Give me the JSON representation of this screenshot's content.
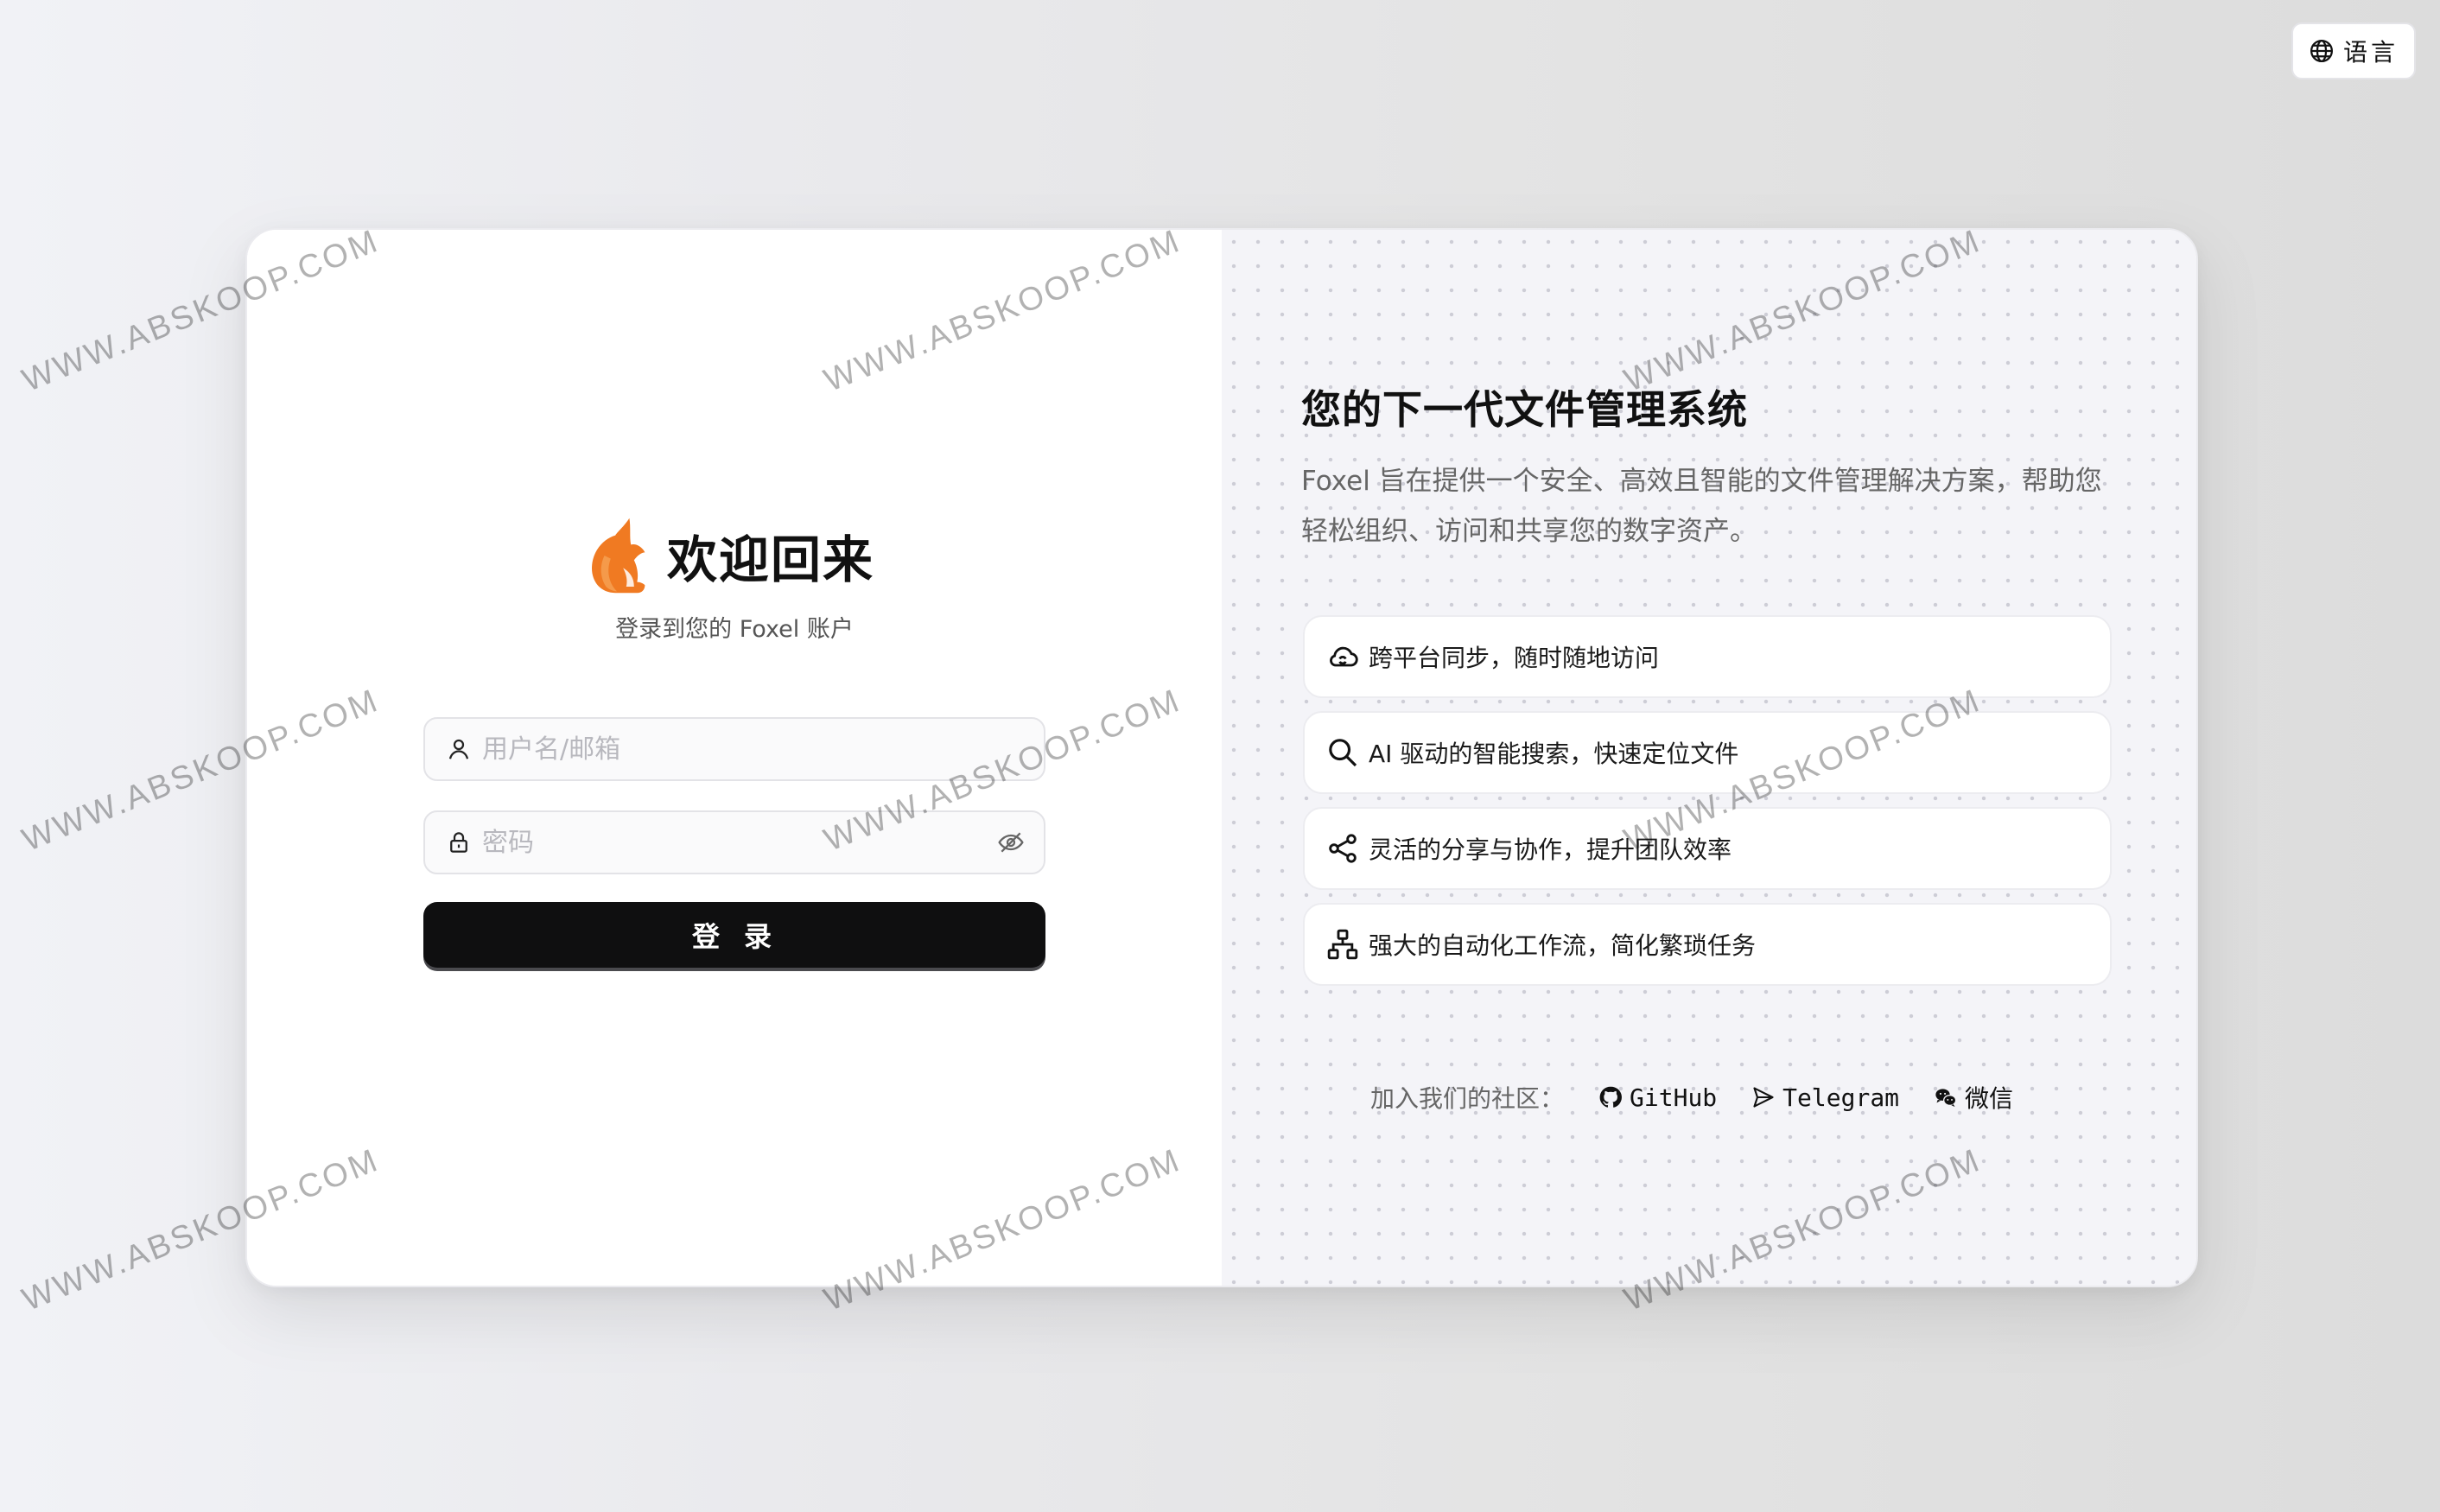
{
  "topbar": {
    "language_label": "语言",
    "language_icon": "globe-icon"
  },
  "login": {
    "title": "欢迎回来",
    "subtitle": "登录到您的 Foxel 账户",
    "logo_icon": "fox-logo-icon",
    "username": {
      "placeholder": "用户名/邮箱",
      "value": "",
      "icon": "user-icon"
    },
    "password": {
      "placeholder": "密码",
      "value": "",
      "icon": "lock-icon",
      "toggle_icon": "eye-off-icon"
    },
    "submit_label": "登录"
  },
  "promo": {
    "title": "您的下一代文件管理系统",
    "description": "Foxel 旨在提供一个安全、高效且智能的文件管理解决方案，帮助您轻松组织、访问和共享您的数字资产。",
    "features": [
      {
        "icon": "cloud-sync-icon",
        "label": "跨平台同步，随时随地访问"
      },
      {
        "icon": "search-icon",
        "label": "AI 驱动的智能搜索，快速定位文件"
      },
      {
        "icon": "share-icon",
        "label": "灵活的分享与协作，提升团队效率"
      },
      {
        "icon": "workflow-icon",
        "label": "强大的自动化工作流，简化繁琐任务"
      }
    ],
    "community": {
      "label": "加入我们的社区：",
      "links": [
        {
          "icon": "github-icon",
          "label": "GitHub"
        },
        {
          "icon": "telegram-icon",
          "label": "Telegram"
        },
        {
          "icon": "wechat-icon",
          "label": "微信"
        }
      ]
    }
  },
  "watermark": {
    "text": "WWW.ABSKOOP.COM"
  },
  "colors": {
    "primary_button": "#0f0f10",
    "logo_orange": "#f07a22",
    "right_panel_bg": "#f4f4f8"
  }
}
